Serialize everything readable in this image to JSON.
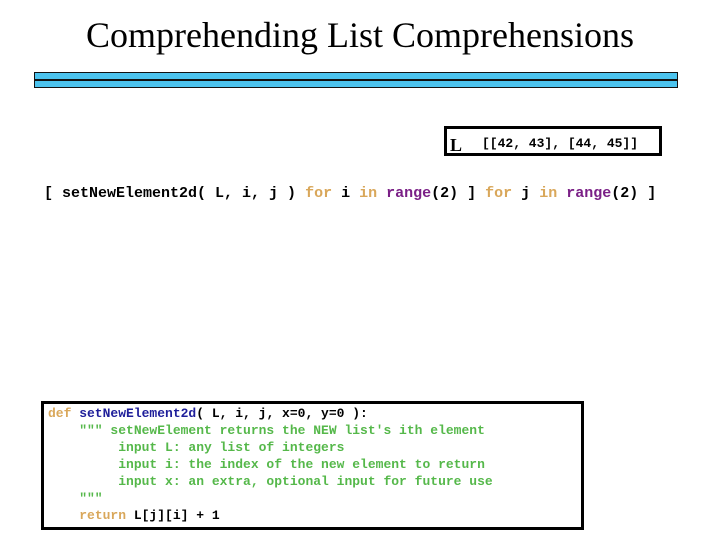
{
  "title": "Comprehending List Comprehensions",
  "variable": {
    "name": "L",
    "value": "[[42, 43], [44, 45]]"
  },
  "comprehension": {
    "open": "[ ",
    "call": "setNewElement2d( L, i, j ) ",
    "kw_for1": "for",
    "var_i": " i ",
    "kw_in1": "in",
    "space1": " ",
    "range1": "range",
    "arg1": "(2) ] ",
    "kw_for2": "for",
    "var_j": " j ",
    "kw_in2": "in",
    "space2": " ",
    "range2": "range",
    "arg2": "(2) ]"
  },
  "code": {
    "def_kw": "def",
    "def_name": " setNewElement2d",
    "def_args": "( L, i, j, x=0, y=0 ):",
    "doc_lines": [
      "    \"\"\" setNewElement returns the NEW list's ith element",
      "         input L: any list of integers",
      "         input i: the index of the new element to return",
      "         input x: an extra, optional input for future use",
      "    \"\"\""
    ],
    "return_indent": "    ",
    "return_kw": "return",
    "return_expr": " L[j][i] + 1"
  }
}
